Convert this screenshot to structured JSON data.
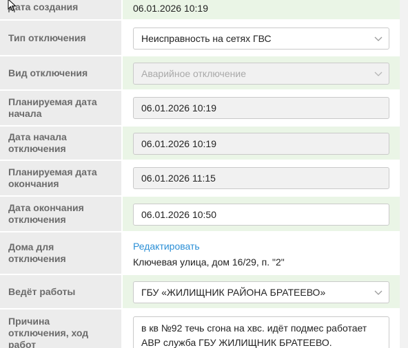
{
  "form": {
    "created": {
      "label": "Дата создания",
      "value": "06.01.2026 10:19"
    },
    "outage_type": {
      "label": "Тип отключения",
      "value": "Неисправность на сетях ГВС"
    },
    "outage_kind": {
      "label": "Вид отключения",
      "value": "Аварийное отключение"
    },
    "planned_start": {
      "label": "Планируемая дата начала",
      "value": "06.01.2026 10:19"
    },
    "start": {
      "label": "Дата начала отключения",
      "value": "06.01.2026 10:19"
    },
    "planned_end": {
      "label": "Планируемая дата окончания",
      "value": "06.01.2026 11:15"
    },
    "end": {
      "label": "Дата окончания отключения",
      "value": "06.01.2026 10:50"
    },
    "houses": {
      "label": "Дома для отключения",
      "edit_link": "Редактировать",
      "address": "Ключевая улица, дом 16/29, п. \"2\""
    },
    "contractor": {
      "label": "Ведёт работы",
      "value": "ГБУ «ЖИЛИЩНИК РАЙОНА БРАТЕЕВО»"
    },
    "reason": {
      "label": "Причина отключения, ход работ",
      "value": "в кв №92 течь сгона на хвс. идёт подмес работает АВР служба ГБУ ЖИЛИЩНИК БРАТЕЕВО."
    }
  }
}
